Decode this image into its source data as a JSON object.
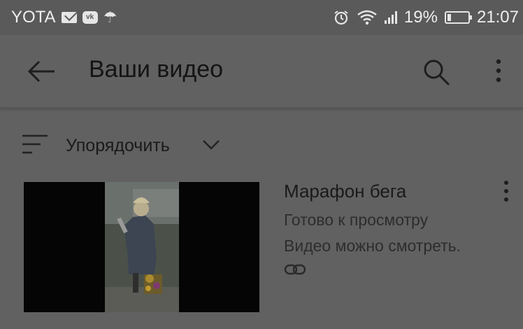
{
  "status_bar": {
    "carrier": "YOTA",
    "notification_icons": [
      "mail-icon",
      "vk-icon",
      "umbrella-icon"
    ],
    "system_icons": [
      "alarm-icon",
      "wifi-icon",
      "signal-icon",
      "battery-icon"
    ],
    "battery_percent": "19%",
    "battery_level": 0.19,
    "time": "21:07"
  },
  "app_bar": {
    "title": "Ваши видео",
    "icons": [
      "back-arrow-icon",
      "search-icon",
      "more-vert-icon"
    ]
  },
  "sort": {
    "label": "Упорядочить",
    "icons": [
      "sort-icon",
      "chevron-down-icon"
    ]
  },
  "videos": [
    {
      "title": "Марафон бега",
      "status": "Готово к просмотру",
      "description": "Видео можно смотреть.",
      "visibility_icon": "link-icon",
      "menu_icon": "more-vert-icon"
    }
  ],
  "colors": {
    "background": "#616161",
    "status_bar": "#5a5a5a",
    "text_primary": "#141414",
    "text_secondary": "#2d2d2d"
  }
}
